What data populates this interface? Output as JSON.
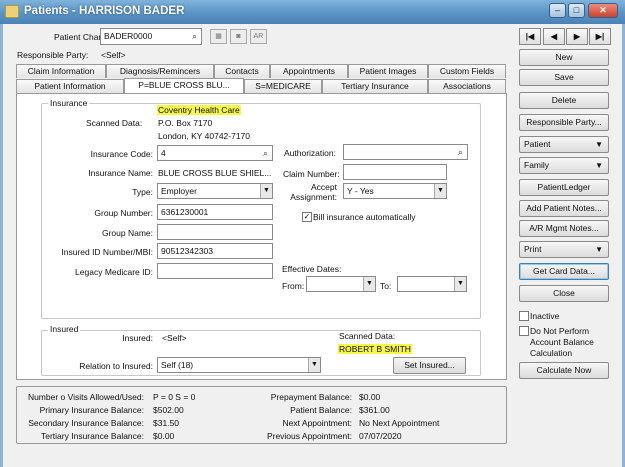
{
  "window": {
    "title": "Patients - HARRISON BADER",
    "min": "–",
    "max": "□",
    "close": "✕"
  },
  "header": {
    "patient_chart_label": "Patient Chart:",
    "patient_chart_value": "BADER0000",
    "ar_label": "AR",
    "responsible_party_label": "Responsible Party:",
    "responsible_party_value": "<Self>"
  },
  "nav": {
    "first": "|◀",
    "prev": "◀",
    "next": "▶",
    "last": "▶|"
  },
  "tabs_row1": [
    "Claim Information",
    "Diagnosis/Remincers",
    "Contacts",
    "Appointments",
    "Patient Images",
    "Custom Fields"
  ],
  "tabs_row2": [
    "Patient Information",
    "P=BLUE CROSS BLU...",
    "S=MEDICARE",
    "Tertiary Insurance",
    "Associations"
  ],
  "insurance": {
    "group_label": "Insurance",
    "company_name": "Coventry Health Care",
    "scanned_data_label": "Scanned Data:",
    "address1": "P.O. Box 7170",
    "address2": "London, KY 40742-7170",
    "insurance_code_label": "Insurance Code:",
    "insurance_code_value": "4",
    "insurance_name_label": "Insurance Name:",
    "insurance_name_value": "BLUE CROSS BLUE SHIEL...",
    "type_label": "Type:",
    "type_value": "Employer",
    "group_number_label": "Group Number:",
    "group_number_value": "6361230001",
    "group_name_label": "Group Name:",
    "group_name_value": "",
    "insured_id_label": "Insured ID Number/MBI:",
    "insured_id_value": "90512342303",
    "legacy_label": "Legacy Medicare ID:",
    "legacy_value": "",
    "authorization_label": "Authorization:",
    "authorization_value": "",
    "claim_number_label": "Claim Number:",
    "claim_number_value": "",
    "accept_assignment_label1": "Accept",
    "accept_assignment_label2": "Assignment:",
    "accept_assignment_value": "Y - Yes",
    "bill_auto_label": "Bill insurance automatically",
    "bill_auto_check": "✓",
    "effective_dates_label": "Effective Dates:",
    "from_label": "From:",
    "to_label": "To:"
  },
  "insured": {
    "group_label": "Insured",
    "insured_label": "Insured:",
    "insured_value": "<Self>",
    "scanned_data_label": "Scanned Data:",
    "scanned_name": "ROBERT B SMITH",
    "relation_label": "Relation to Insured:",
    "relation_value": "Self (18)",
    "set_insured_button": "Set Insured..."
  },
  "summary": {
    "visits_label": "Number o Visits Allowed/Used:",
    "visits_value": "P = 0  S = 0",
    "primary_label": "Primary Insurance Balance:",
    "primary_value": "$502.00",
    "secondary_label": "Secondary Insurance Balance:",
    "secondary_value": "$31.50",
    "tertiary_label": "Tertiary Insurance Balance:",
    "tertiary_value": "$0.00",
    "prepayment_label": "Prepayment Balance:",
    "prepayment_value": "$0.00",
    "patient_label": "Patient Balance:",
    "patient_value": "$361.00",
    "next_appt_label": "Next Appointment:",
    "next_appt_value": "No Next Appointment",
    "prev_appt_label": "Previous Appointment:",
    "prev_appt_value": "07/07/2020"
  },
  "sidebar": {
    "new": "New",
    "save": "Save",
    "delete": "Delete",
    "responsible_party": "Responsible Party...",
    "patient": "Patient",
    "family": "Family",
    "patient_ledger": "PatientLedger",
    "add_patient_notes": "Add Patient Notes...",
    "ar_mgmt_notes": "A/R Mgmt Notes...",
    "print": "Print",
    "get_card_data": "Get Card Data...",
    "close": "Close",
    "inactive": "Inactive",
    "do_not_perform_1": "Do Not Perform",
    "do_not_perform_2": "Account Balance",
    "do_not_perform_3": "Calculation",
    "calculate_now": "Calculate Now"
  },
  "colors": {
    "title_bar": "#5a93c4",
    "highlight": "#f6f54a"
  }
}
